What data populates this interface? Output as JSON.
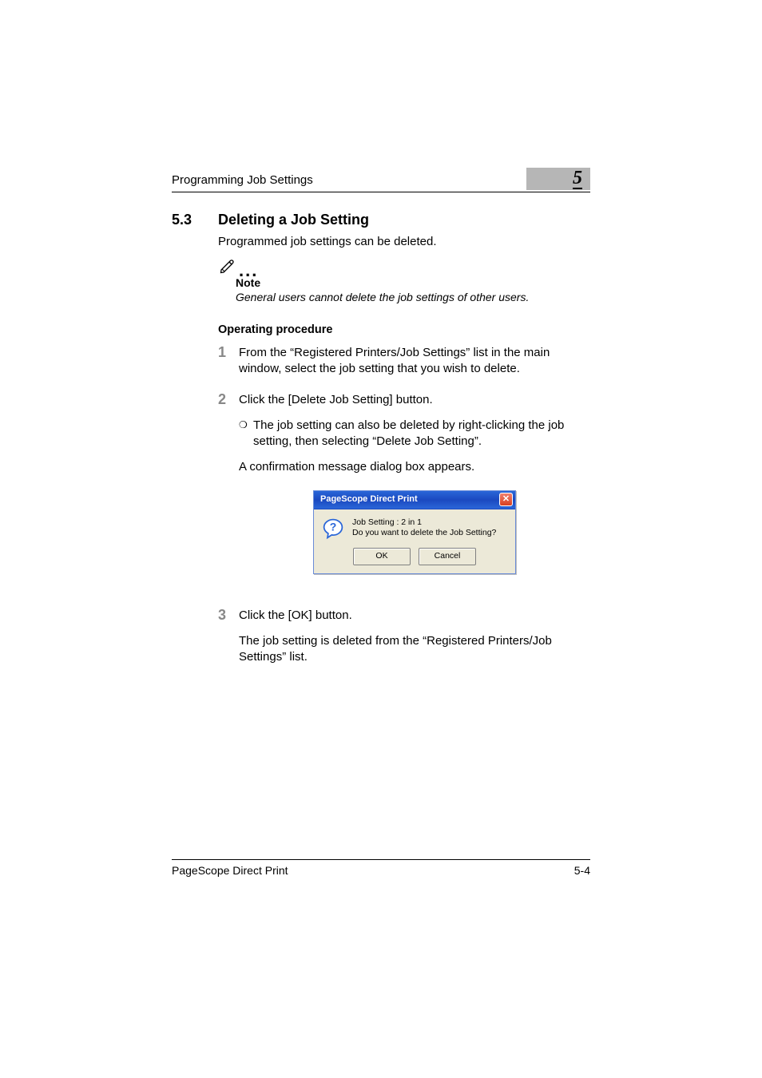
{
  "header": {
    "title": "Programming Job Settings",
    "chapter_number": "5"
  },
  "section": {
    "number": "5.3",
    "title": "Deleting a Job Setting",
    "intro": "Programmed job settings can be deleted."
  },
  "note": {
    "dots": "...",
    "label": "Note",
    "text": "General users cannot delete the job settings of other users."
  },
  "operating_procedure_heading": "Operating procedure",
  "steps": {
    "s1": {
      "n": "1",
      "text": "From the “Registered Printers/Job Settings” list in the main window, select the job setting that you wish to delete."
    },
    "s2": {
      "n": "2",
      "text": "Click the [Delete Job Setting] button.",
      "sub_bullet": "❍",
      "sub": "The job setting can also be deleted by right-clicking the job setting, then selecting “Delete Job Setting”.",
      "after": "A confirmation message dialog box appears."
    },
    "s3": {
      "n": "3",
      "text": "Click the [OK] button.",
      "after": "The job setting is deleted from the “Registered Printers/Job Settings” list."
    }
  },
  "dialog": {
    "title": "PageScope Direct Print",
    "close_glyph": "✕",
    "line1": "Job Setting : 2 in 1",
    "line2": "Do you want to delete the Job Setting?",
    "ok": "OK",
    "cancel": "Cancel"
  },
  "footer": {
    "product": "PageScope Direct Print",
    "page": "5-4"
  }
}
